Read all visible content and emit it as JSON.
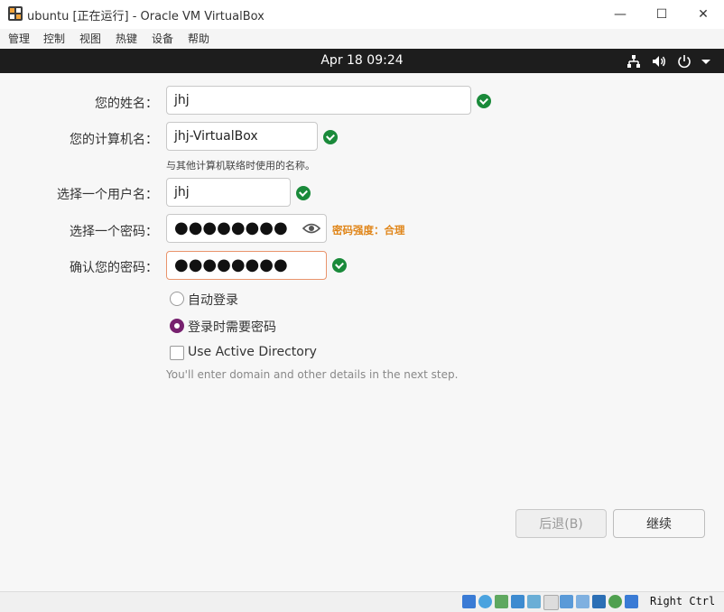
{
  "window": {
    "title": "ubuntu [正在运行] - Oracle VM VirtualBox",
    "min_symbol": "—",
    "max_symbol": "☐",
    "close_symbol": "✕"
  },
  "menubar": {
    "items": [
      "管理",
      "控制",
      "视图",
      "热键",
      "设备",
      "帮助"
    ]
  },
  "topbar": {
    "clock": "Apr 18  09:24",
    "icons": [
      "network-icon",
      "volume-icon",
      "power-icon",
      "chevron-down-icon"
    ]
  },
  "form": {
    "name": {
      "label": "您的姓名：",
      "value": "jhj"
    },
    "computer": {
      "label": "您的计算机名：",
      "value": "jhj-VirtualBox",
      "hint": "与其他计算机联络时使用的名称。"
    },
    "username": {
      "label": "选择一个用户名：",
      "value": "jhj"
    },
    "password": {
      "label": "选择一个密码：",
      "value": "●●●●●●●●",
      "strength": "密码强度：合理"
    },
    "confirm": {
      "label": "确认您的密码：",
      "value": "●●●●●●●●"
    },
    "auto_login": {
      "label": "自动登录",
      "selected": false
    },
    "require_password": {
      "label": "登录时需要密码",
      "selected": true
    },
    "active_directory": {
      "label": "Use Active Directory",
      "checked": false,
      "hint": "You'll enter domain and other details in the next step."
    }
  },
  "buttons": {
    "back": "后退(B)",
    "next": "继续"
  },
  "statusbar": {
    "hostkey": "Right Ctrl"
  },
  "colors": {
    "accent": "#77216f",
    "check": "#1a8a3a",
    "strength": "#e0861a",
    "focus": "#e9946c"
  }
}
